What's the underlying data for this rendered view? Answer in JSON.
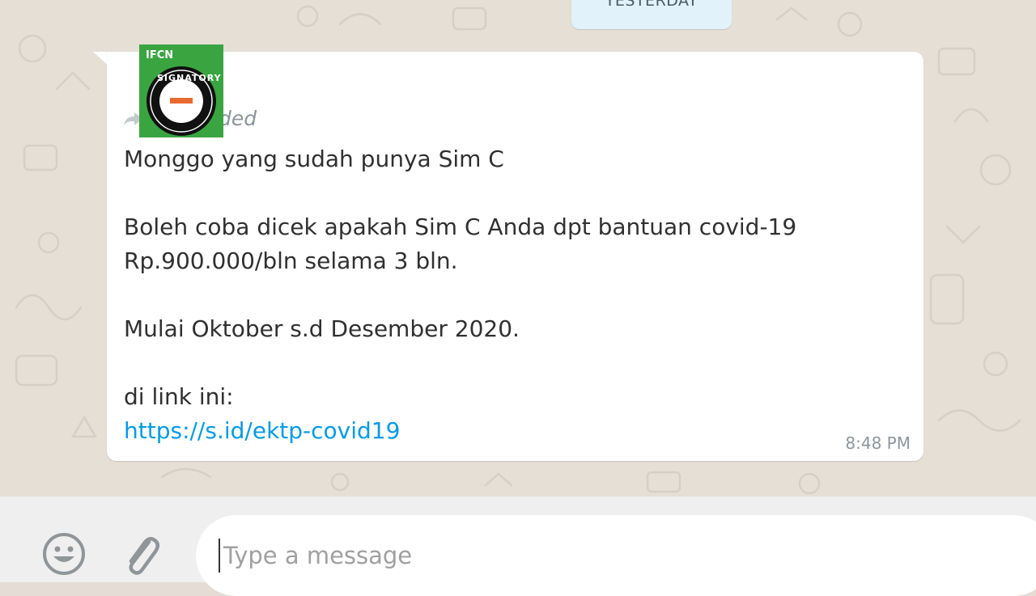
{
  "chat": {
    "date_chip": "YESTERDAY"
  },
  "message": {
    "forwarded_label": "Forwarded",
    "text": "Monggo yang sudah punya Sim C\n\nBoleh coba dicek apakah Sim C Anda dpt bantuan covid-19\nRp.900.000/bln selama 3 bln.\n\nMulai Oktober s.d Desember 2020.\n\ndi link ini:",
    "link": "https://s.id/ektp-covid19",
    "time": "8:48 PM"
  },
  "badge": {
    "org": "IFCN",
    "label": "SIGNATORY"
  },
  "composer": {
    "placeholder": "Type a message"
  },
  "icons": {
    "emoji": "emoji-icon",
    "attach": "paperclip-icon",
    "forward": "forward-arrow-icon"
  },
  "colors": {
    "chat_background": "#e6dfd6",
    "bubble": "#ffffff",
    "link": "#039be5",
    "badge_green": "#3aa540"
  }
}
